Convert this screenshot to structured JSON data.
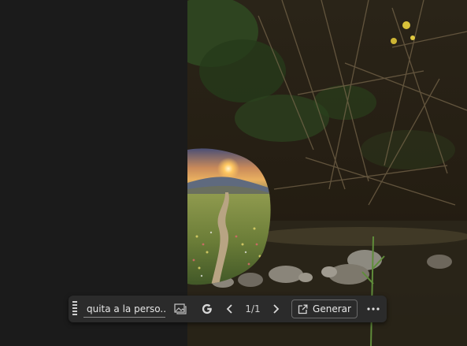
{
  "toolbar": {
    "prompt_text": "quita a la perso...",
    "page_indicator": "1/1",
    "generate_label": "Generar",
    "icons": {
      "grip": "drag-handle-icon",
      "image": "image-compare-icon",
      "google": "google-icon",
      "prev": "chevron-left-icon",
      "next": "chevron-right-icon",
      "generate": "external-edit-icon",
      "more": "more-horizontal-icon"
    }
  },
  "colors": {
    "toolbar_bg": "#2b2b2b",
    "panel_bg": "#1b1b1b",
    "text": "#e6e6e6"
  }
}
